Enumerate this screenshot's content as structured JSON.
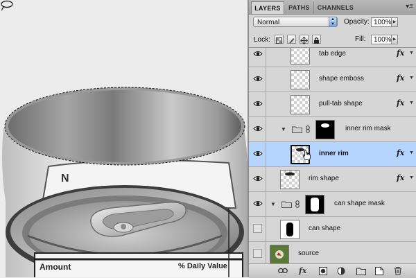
{
  "panel": {
    "tabs": [
      {
        "label": "LAYERS",
        "active": true
      },
      {
        "label": "PATHS",
        "active": false
      },
      {
        "label": "CHANNELS",
        "active": false
      }
    ],
    "menu_icon": "panel-menu-icon",
    "blend_mode": "Normal",
    "opacity_label": "Opacity:",
    "opacity_value": "100%",
    "lock_label": "Lock:",
    "fill_label": "Fill:",
    "fill_value": "100%"
  },
  "layers": [
    {
      "name": "tab edge",
      "visible": true,
      "fx": true,
      "thumb": "transparent"
    },
    {
      "name": "shape emboss",
      "visible": true,
      "fx": true,
      "thumb": "transparent"
    },
    {
      "name": "pull-tab shape",
      "visible": true,
      "fx": true,
      "thumb": "transparent"
    },
    {
      "name": "inner rim mask",
      "visible": true,
      "fx": false,
      "group": true,
      "expanded": true
    },
    {
      "name": "inner rim",
      "visible": true,
      "fx": true,
      "selected": true
    },
    {
      "name": "rim shape",
      "visible": true,
      "fx": true,
      "thumb": "transparent"
    },
    {
      "name": "can shape mask",
      "visible": true,
      "fx": false,
      "group": true,
      "expanded": true
    },
    {
      "name": "can shape",
      "visible": false,
      "fx": false,
      "thumb": "black"
    },
    {
      "name": "source",
      "visible": false,
      "fx": false,
      "thumb": "source"
    }
  ],
  "fx_label": "fx",
  "canvas": {
    "label_amount": "Amount",
    "label_daily_value": "% Daily Value"
  },
  "colors": {
    "selected_row": "#b5d5fe",
    "panel_bg": "#d6d6d6",
    "canvas_bg": "#ececec"
  }
}
